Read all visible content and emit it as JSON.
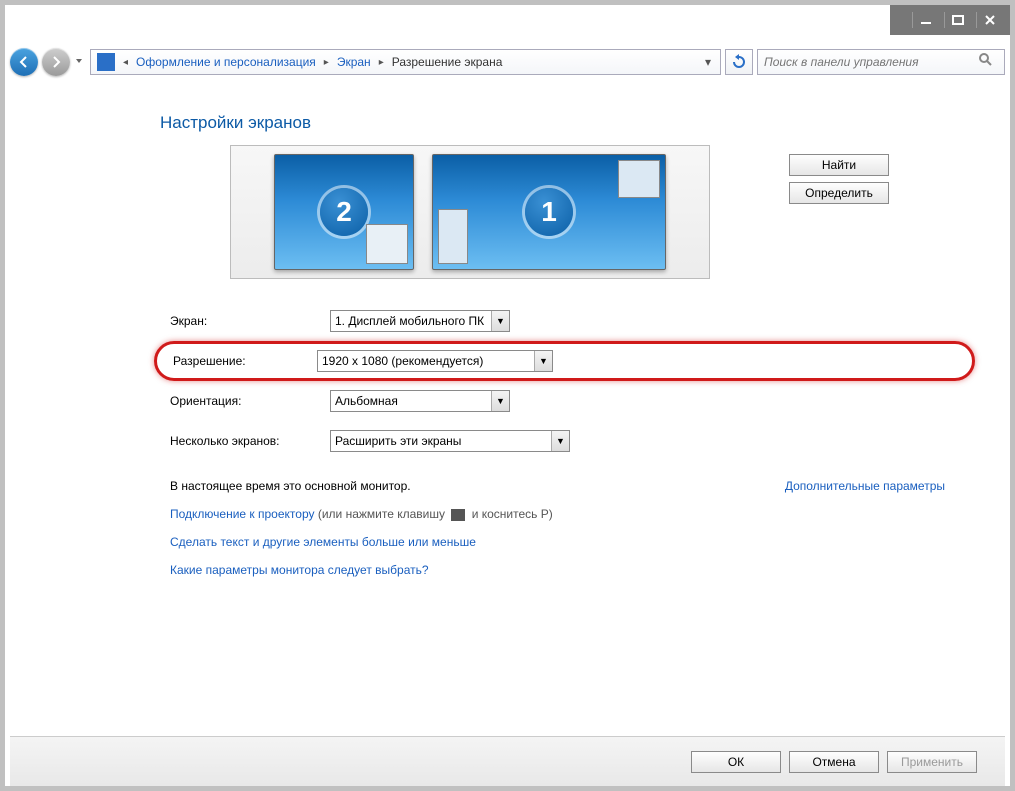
{
  "breadcrumb": {
    "seg1": "Оформление и персонализация",
    "seg2": "Экран",
    "seg3": "Разрешение экрана"
  },
  "search": {
    "placeholder": "Поиск в панели управления"
  },
  "title": "Настройки экранов",
  "monitors": {
    "first": "1",
    "second": "2"
  },
  "buttons": {
    "detect": "Найти",
    "identify": "Определить",
    "ok": "ОК",
    "cancel": "Отмена",
    "apply": "Применить"
  },
  "form": {
    "display_label": "Экран:",
    "display_value": "1. Дисплей мобильного ПК",
    "resolution_label": "Разрешение:",
    "resolution_value": "1920 x 1080 (рекомендуется)",
    "orientation_label": "Ориентация:",
    "orientation_value": "Альбомная",
    "multi_label": "Несколько экранов:",
    "multi_value": "Расширить эти экраны"
  },
  "info": {
    "primary": "В настоящее время это основной монитор.",
    "advanced": "Дополнительные параметры"
  },
  "links": {
    "projector_a": "Подключение к проектору",
    "projector_b": " (или нажмите клавишу ",
    "projector_c": " и коснитесь P)",
    "textsize": "Сделать текст и другие элементы больше или меньше",
    "help": "Какие параметры монитора следует выбрать?"
  },
  "colors": {
    "link": "#1a5fbf",
    "highlight": "#d01a1a"
  }
}
